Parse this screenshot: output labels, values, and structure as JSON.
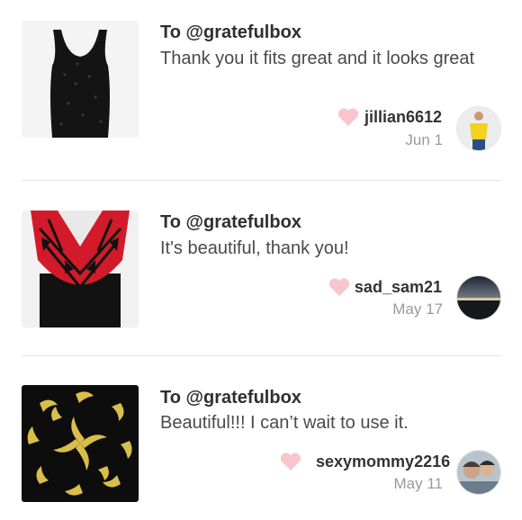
{
  "reviews": [
    {
      "to": "To @gratefulbox",
      "message": "Thank you it fits great and it looks great",
      "username": "jillian6612",
      "date": "Jun 1",
      "product_icon": "black-sequin-top-image",
      "avatar_icon": "user-avatar-yellow-top"
    },
    {
      "to": "To @gratefulbox",
      "message": "It's beautiful, thank you!",
      "username": "sad_sam21",
      "date": "May 17",
      "product_icon": "red-black-scarf-image",
      "avatar_icon": "user-avatar-sunset"
    },
    {
      "to": "To @gratefulbox",
      "message": "Beautiful!!! I can’t wait to use it.",
      "username": "sexymommy2216",
      "date": "May 11",
      "product_icon": "black-yellow-swirl-scarf-image",
      "avatar_icon": "user-avatar-photo"
    }
  ],
  "colors": {
    "heart": "#f7c6cc",
    "divider": "#e2e2e2",
    "date_text": "#9a9a9a"
  }
}
